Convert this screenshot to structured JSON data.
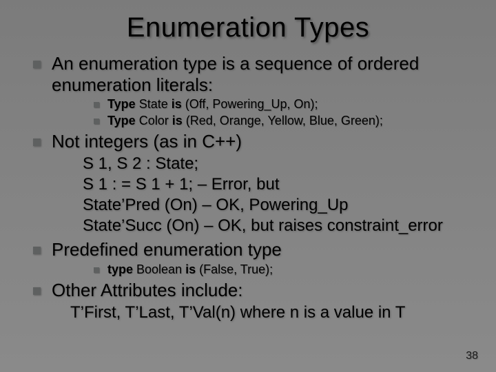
{
  "title": "Enumeration Types",
  "points": [
    {
      "text": "An enumeration type is a sequence of ordered enumeration literals:",
      "sub": [
        {
          "pre": "Type",
          "mid": " State ",
          "mid2": "is",
          "post": " (Off, Powering_Up, On);"
        },
        {
          "pre": "Type",
          "mid": " Color ",
          "mid2": "is",
          "post": " (Red, Orange, Yellow, Blue, Green);"
        }
      ]
    },
    {
      "text": "Not integers (as in C++)",
      "code": [
        "S 1, S 2 : State;",
        "S 1 : = S 1 + 1; – Error, but",
        "State’Pred (On) – OK, Powering_Up",
        "State’Succ (On) – OK, but raises constraint_error"
      ]
    },
    {
      "text": "Predefined enumeration type",
      "sub": [
        {
          "pre": "type",
          "mid": " Boolean ",
          "mid2": "is",
          "post": " (False, True);"
        }
      ]
    },
    {
      "text": "Other Attributes include:",
      "footer": "T’First, T’Last, T’Val(n) where n is a value in T"
    }
  ],
  "page_number": "38"
}
